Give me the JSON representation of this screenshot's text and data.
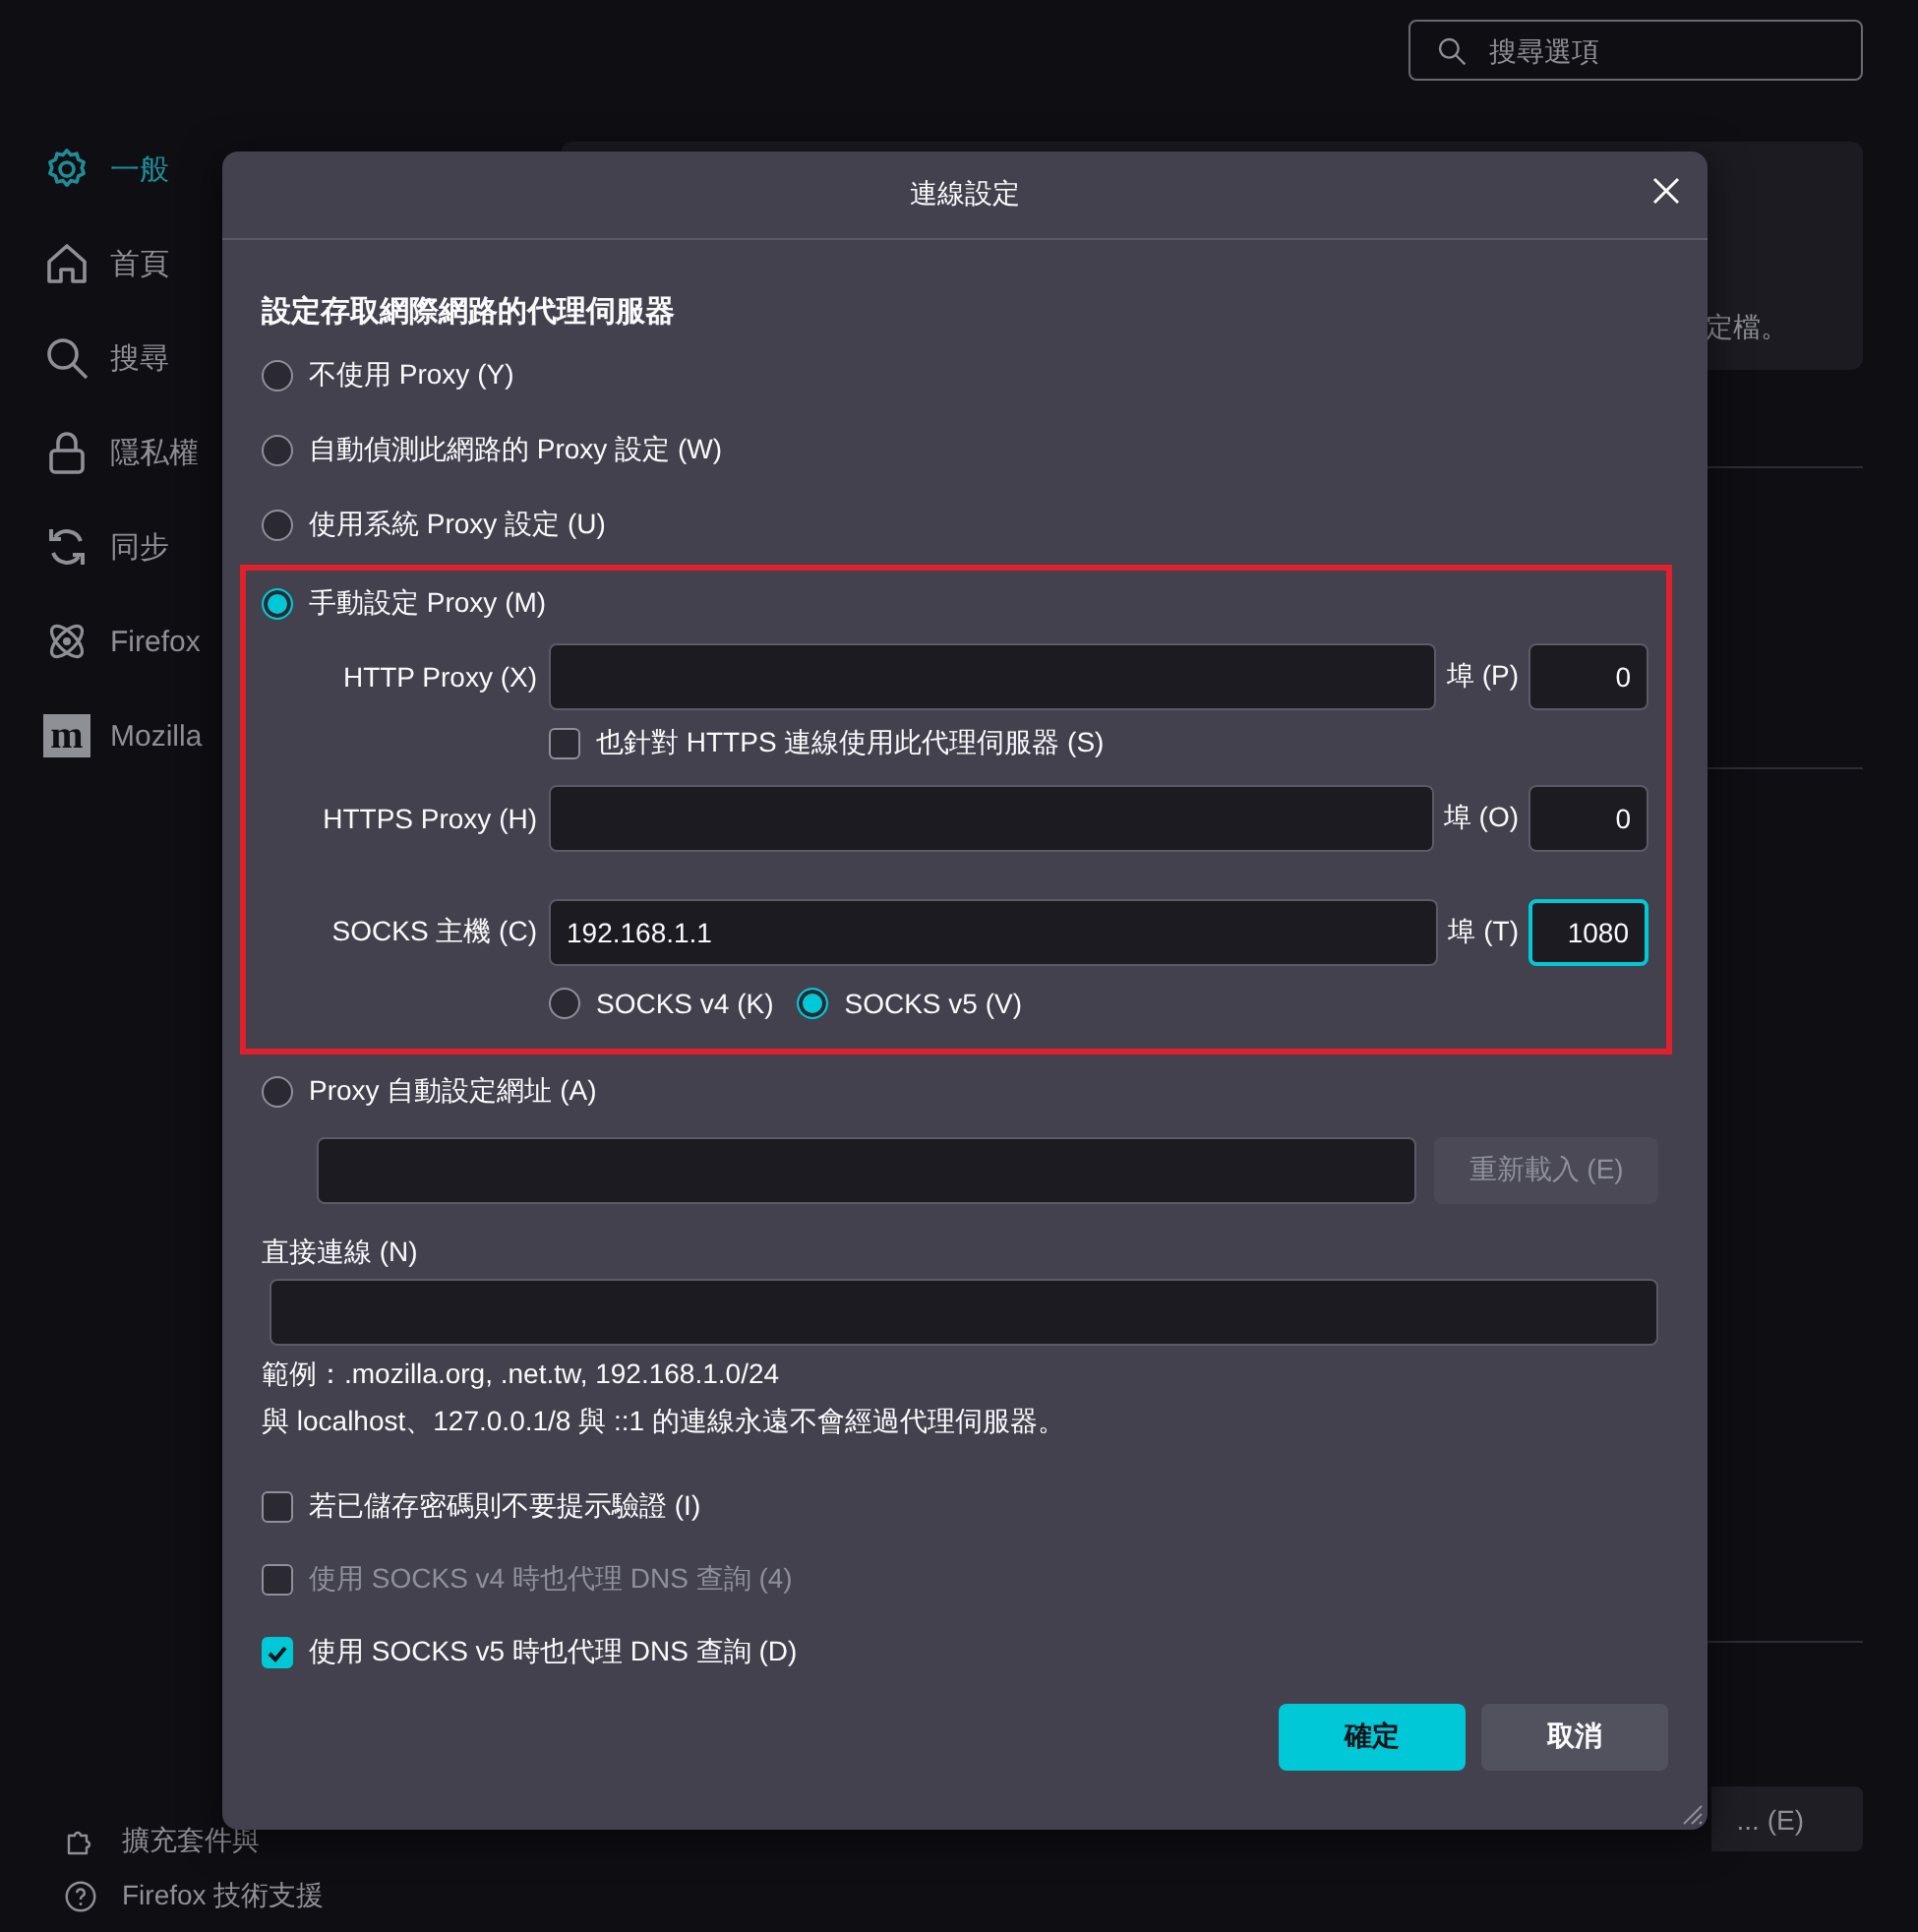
{
  "search": {
    "placeholder": "搜尋選項"
  },
  "sidebar": {
    "items": [
      {
        "label": "一般",
        "selected": true
      },
      {
        "label": "首頁",
        "selected": false
      },
      {
        "label": "搜尋",
        "selected": false
      },
      {
        "label": "隱私權",
        "selected": false
      },
      {
        "label": "同步",
        "selected": false
      },
      {
        "label": "Firefox",
        "selected": false
      },
      {
        "label": "Mozilla",
        "badge": "m",
        "selected": false
      }
    ],
    "footer": [
      {
        "label": "擴充套件與"
      },
      {
        "label": "Firefox 技術支援"
      }
    ]
  },
  "content": {
    "card_text": "定檔。",
    "button_label": "... (E)"
  },
  "dialog": {
    "title": "連線設定",
    "heading": "設定存取網際網路的代理伺服器",
    "proxy_modes": [
      {
        "kind": "simple",
        "label": "不使用 Proxy (Y)",
        "selected": false
      },
      {
        "kind": "simple",
        "label": "自動偵測此網路的 Proxy 設定 (W)",
        "selected": false
      },
      {
        "kind": "simple",
        "label": "使用系統 Proxy 設定 (U)",
        "selected": false
      },
      {
        "kind": "manual",
        "label": "手動設定 Proxy (M)",
        "selected": true,
        "http": {
          "label": "HTTP Proxy (X)",
          "port_label": "埠 (P)",
          "port": "0"
        },
        "also_https": {
          "label": "也針對 HTTPS 連線使用此代理伺服器 (S)",
          "checked": false
        },
        "https": {
          "label": "HTTPS Proxy (H)",
          "port_label": "埠 (O)",
          "port": "0"
        },
        "socks": {
          "label": "SOCKS 主機 (C)",
          "value": "192.168.1.1",
          "port_label": "埠 (T)",
          "port": "1080",
          "focused": true
        },
        "socks_versions": [
          {
            "label": "SOCKS v4 (K)",
            "selected": false
          },
          {
            "label": "SOCKS v5 (V)",
            "selected": true
          }
        ]
      },
      {
        "kind": "autoconfig",
        "label": "Proxy 自動設定網址 (A)",
        "selected": false,
        "reload_button": {
          "label": "重新載入 (E)",
          "disabled": true
        }
      }
    ],
    "no_proxy": {
      "label": "直接連線 (N)"
    },
    "example": "範例：.mozilla.org, .net.tw, 192.168.1.0/24",
    "note": "與 localhost、127.0.0.1/8 與 ::1 的連線永遠不會經過代理伺服器。",
    "options": [
      {
        "label": "若已儲存密碼則不要提示驗證 (I)",
        "checked": false,
        "disabled": false
      },
      {
        "label": "使用 SOCKS v4 時也代理 DNS 查詢 (4)",
        "checked": false,
        "disabled": true
      },
      {
        "label": "使用 SOCKS v5 時也代理 DNS 查詢 (D)",
        "checked": true,
        "disabled": false
      }
    ],
    "buttons": [
      {
        "label": "確定",
        "kind": "primary"
      },
      {
        "label": "取消",
        "kind": "secondary"
      }
    ]
  }
}
